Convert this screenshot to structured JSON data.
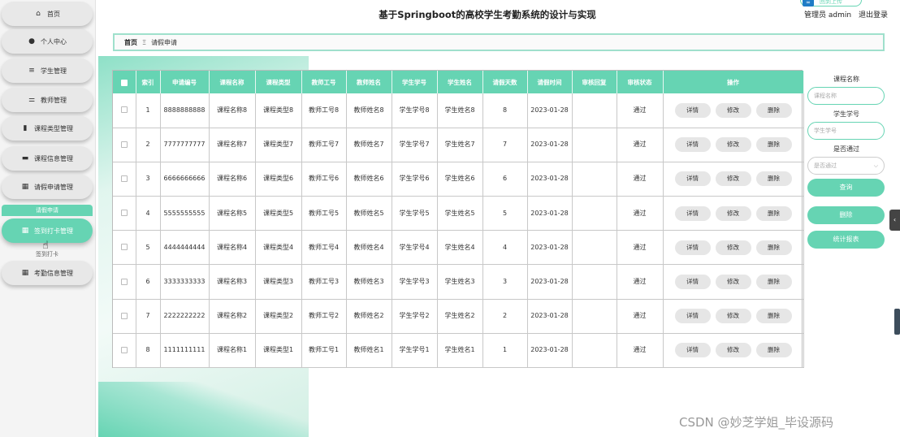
{
  "app": {
    "title": "基于Springboot的高校学生考勤系统的设计与实现",
    "top_button": "回到上传",
    "user_label": "管理员 admin",
    "logout": "退出登录"
  },
  "sidebar": {
    "items": [
      {
        "label": "首页",
        "icon": "home-icon",
        "glyph": "⌂"
      },
      {
        "label": "个人中心",
        "icon": "person-icon",
        "glyph": "●"
      },
      {
        "label": "学生管理",
        "icon": "list-icon",
        "glyph": "≡"
      },
      {
        "label": "教师管理",
        "icon": "sliders-icon",
        "glyph": "⚌"
      },
      {
        "label": "课程类型管理",
        "icon": "bar-chart-icon",
        "glyph": "▮"
      },
      {
        "label": "课程信息管理",
        "icon": "monitor-icon",
        "glyph": "▬"
      },
      {
        "label": "请假申请管理",
        "icon": "grid-icon",
        "glyph": "▦"
      },
      {
        "label": "签到打卡管理",
        "icon": "grid-icon",
        "glyph": "▦"
      },
      {
        "label": "考勤信息管理",
        "icon": "grid-icon",
        "glyph": "▦"
      }
    ],
    "sub_top": "请假申请",
    "sub_bottom": "签到打卡"
  },
  "breadcrumb": {
    "home": "首页",
    "sep": "Ξ",
    "current": "请假申请"
  },
  "table": {
    "headers": [
      "索引",
      "申请编号",
      "课程名称",
      "课程类型",
      "教师工号",
      "教师姓名",
      "学生学号",
      "学生姓名",
      "请假天数",
      "请假时间",
      "审核回复",
      "审核状态",
      "操作"
    ],
    "rows": [
      {
        "idx": "1",
        "code": "8888888888",
        "course": "课程名称8",
        "ctype": "课程类型8",
        "tno": "教师工号8",
        "tname": "教师姓名8",
        "sno": "学生学号8",
        "sname": "学生姓名8",
        "days": "8",
        "time": "2023-01-28",
        "reply": "",
        "status": "通过"
      },
      {
        "idx": "2",
        "code": "7777777777",
        "course": "课程名称7",
        "ctype": "课程类型7",
        "tno": "教师工号7",
        "tname": "教师姓名7",
        "sno": "学生学号7",
        "sname": "学生姓名7",
        "days": "7",
        "time": "2023-01-28",
        "reply": "",
        "status": "通过"
      },
      {
        "idx": "3",
        "code": "6666666666",
        "course": "课程名称6",
        "ctype": "课程类型6",
        "tno": "教师工号6",
        "tname": "教师姓名6",
        "sno": "学生学号6",
        "sname": "学生姓名6",
        "days": "6",
        "time": "2023-01-28",
        "reply": "",
        "status": "通过"
      },
      {
        "idx": "4",
        "code": "5555555555",
        "course": "课程名称5",
        "ctype": "课程类型5",
        "tno": "教师工号5",
        "tname": "教师姓名5",
        "sno": "学生学号5",
        "sname": "学生姓名5",
        "days": "5",
        "time": "2023-01-28",
        "reply": "",
        "status": "通过"
      },
      {
        "idx": "5",
        "code": "4444444444",
        "course": "课程名称4",
        "ctype": "课程类型4",
        "tno": "教师工号4",
        "tname": "教师姓名4",
        "sno": "学生学号4",
        "sname": "学生姓名4",
        "days": "4",
        "time": "2023-01-28",
        "reply": "",
        "status": "通过"
      },
      {
        "idx": "6",
        "code": "3333333333",
        "course": "课程名称3",
        "ctype": "课程类型3",
        "tno": "教师工号3",
        "tname": "教师姓名3",
        "sno": "学生学号3",
        "sname": "学生姓名3",
        "days": "3",
        "time": "2023-01-28",
        "reply": "",
        "status": "通过"
      },
      {
        "idx": "7",
        "code": "2222222222",
        "course": "课程名称2",
        "ctype": "课程类型2",
        "tno": "教师工号2",
        "tname": "教师姓名2",
        "sno": "学生学号2",
        "sname": "学生姓名2",
        "days": "2",
        "time": "2023-01-28",
        "reply": "",
        "status": "通过"
      },
      {
        "idx": "8",
        "code": "1111111111",
        "course": "课程名称1",
        "ctype": "课程类型1",
        "tno": "教师工号1",
        "tname": "教师姓名1",
        "sno": "学生学号1",
        "sname": "学生姓名1",
        "days": "1",
        "time": "2023-01-28",
        "reply": "",
        "status": "通过"
      }
    ],
    "actions": {
      "detail": "详情",
      "edit": "修改",
      "delete": "删除"
    }
  },
  "search": {
    "course_label": "课程名称",
    "course_placeholder": "课程名称",
    "student_label": "学生学号",
    "student_placeholder": "学生学号",
    "passed_label": "是否通过",
    "passed_placeholder": "是否通过",
    "query_button": "查询",
    "delete_button": "删除",
    "stats_button": "统计报表"
  },
  "watermark": "CSDN @妙芝学姐_毕设源码",
  "colors": {
    "accent": "#66d4b3"
  }
}
